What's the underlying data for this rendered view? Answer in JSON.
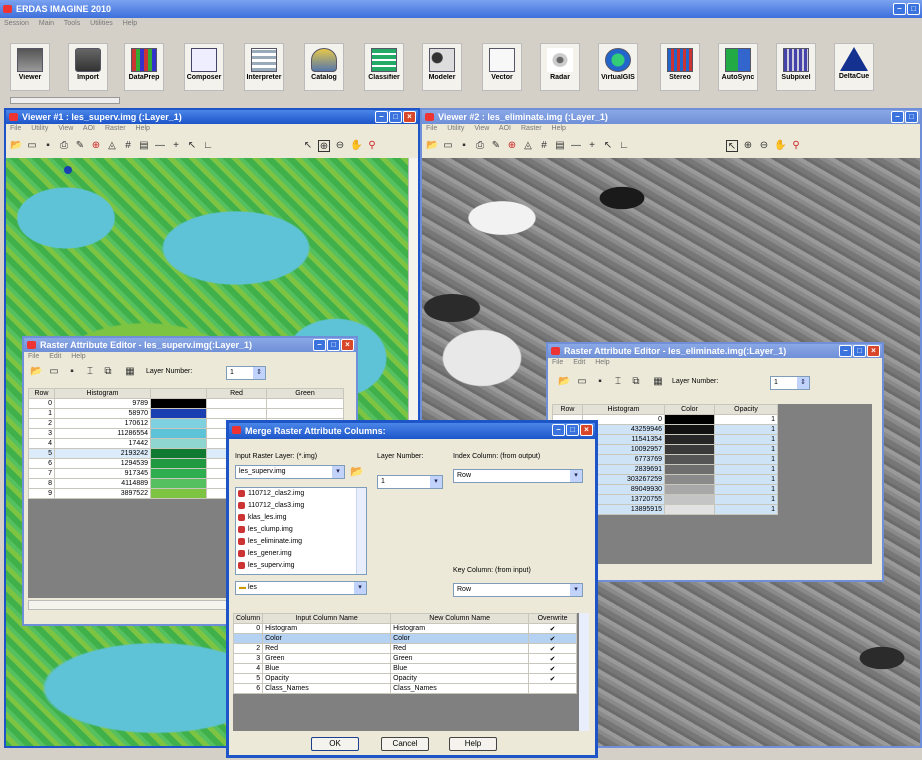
{
  "app": {
    "title": "ERDAS IMAGINE 2010",
    "menu": [
      "Session",
      "Main",
      "Tools",
      "Utilities",
      "Help"
    ]
  },
  "toolbar": [
    {
      "label": "Viewer",
      "icon": "viewer-icon"
    },
    {
      "label": "Import",
      "icon": "import-icon"
    },
    {
      "label": "DataPrep",
      "icon": "dataprep-icon"
    },
    {
      "label": "Composer",
      "icon": "composer-icon"
    },
    {
      "label": "Interpreter",
      "icon": "interpreter-icon"
    },
    {
      "label": "Catalog",
      "icon": "catalog-icon"
    },
    {
      "label": "Classifier",
      "icon": "classifier-icon"
    },
    {
      "label": "Modeler",
      "icon": "modeler-icon"
    },
    {
      "label": "Vector",
      "icon": "vector-icon"
    },
    {
      "label": "Radar",
      "icon": "radar-icon"
    },
    {
      "label": "VirtualGIS",
      "icon": "virtualgis-icon"
    },
    {
      "label": "Stereo",
      "icon": "stereo-icon"
    },
    {
      "label": "AutoSync",
      "icon": "autosync-icon"
    },
    {
      "label": "Subpixel",
      "icon": "subpixel-icon"
    },
    {
      "label": "DeltaCue",
      "icon": "deltacue-icon"
    }
  ],
  "viewer1": {
    "title": "Viewer #1 : les_superv.img (:Layer_1)",
    "menu": [
      "File",
      "Utility",
      "View",
      "AOI",
      "Raster",
      "Help"
    ]
  },
  "viewer2": {
    "title": "Viewer #2 : les_eliminate.img (:Layer_1)",
    "menu": [
      "File",
      "Utility",
      "View",
      "AOI",
      "Raster",
      "Help"
    ]
  },
  "rae1": {
    "title": "Raster Attribute Editor - les_superv.img(:Layer_1)",
    "menu": [
      "File",
      "Edit",
      "Help"
    ],
    "layer_label": "Layer Number:",
    "layer_value": "1",
    "columns": [
      "Row",
      "Histogram",
      "",
      "Red",
      "Green"
    ],
    "rows": [
      {
        "row": "0",
        "hist": "9789",
        "color": "#000000"
      },
      {
        "row": "1",
        "hist": "58970",
        "color": "#1a3fb0"
      },
      {
        "row": "2",
        "hist": "170612",
        "color": "#7fd1e0"
      },
      {
        "row": "3",
        "hist": "11286554",
        "color": "#5fc3d8"
      },
      {
        "row": "4",
        "hist": "17442",
        "color": "#8fd6d0"
      },
      {
        "row": "5",
        "hist": "2193242",
        "color": "#0f7a30"
      },
      {
        "row": "6",
        "hist": "1294539",
        "color": "#1f9a40"
      },
      {
        "row": "7",
        "hist": "917345",
        "color": "#2fae50"
      },
      {
        "row": "8",
        "hist": "4114889",
        "color": "#55c060"
      },
      {
        "row": "9",
        "hist": "3897522",
        "color": "#7cc442"
      }
    ]
  },
  "rae2": {
    "title": "Raster Attribute Editor - les_eliminate.img(:Layer_1)",
    "menu": [
      "File",
      "Edit",
      "Help"
    ],
    "layer_label": "Layer Number:",
    "layer_value": "1",
    "columns": [
      "Row",
      "Histogram",
      "Color",
      "Opacity"
    ],
    "rows": [
      {
        "row": "",
        "hist": "0",
        "color": "#000000",
        "opacity": "1"
      },
      {
        "row": "",
        "hist": "43259946",
        "color": "#111111",
        "opacity": "1"
      },
      {
        "row": "",
        "hist": "11541354",
        "color": "#262626",
        "opacity": "1"
      },
      {
        "row": "",
        "hist": "10092957",
        "color": "#3a3a3a",
        "opacity": "1"
      },
      {
        "row": "",
        "hist": "6773769",
        "color": "#555555",
        "opacity": "1"
      },
      {
        "row": "",
        "hist": "2839691",
        "color": "#6e6e6e",
        "opacity": "1"
      },
      {
        "row": "",
        "hist": "303267259",
        "color": "#8a8a8a",
        "opacity": "1"
      },
      {
        "row": "",
        "hist": "89049930",
        "color": "#a8a8a8",
        "opacity": "1"
      },
      {
        "row": "",
        "hist": "13720755",
        "color": "#c4c4c4",
        "opacity": "1"
      },
      {
        "row": "",
        "hist": "13895915",
        "color": "#e2e2e2",
        "opacity": "1"
      }
    ]
  },
  "merge": {
    "title": "Merge Raster Attribute Columns:",
    "input_label": "Input Raster Layer: (*.img)",
    "input_value": "les_superv.img",
    "files": [
      "110712_clas2.img",
      "110712_clas3.img",
      "klas_les.img",
      "les_clump.img",
      "les_eliminate.img",
      "les_gener.img",
      "les_superv.img"
    ],
    "folder": "les",
    "layer_label": "Layer Number:",
    "layer_value": "1",
    "index_label": "Index Column: (from output)",
    "index_value": "Row",
    "key_label": "Key Column: (from input)",
    "key_value": "Row",
    "columns": [
      "Column",
      "Input Column Name",
      "New Column Name",
      "Overwrite"
    ],
    "rows": [
      {
        "col": "0",
        "input": "Histogram",
        "new": "Histogram",
        "overwrite": "✔"
      },
      {
        "col": "",
        "input": "Color",
        "new": "Color",
        "overwrite": "✔"
      },
      {
        "col": "2",
        "input": "Red",
        "new": "Red",
        "overwrite": "✔"
      },
      {
        "col": "3",
        "input": "Green",
        "new": "Green",
        "overwrite": "✔"
      },
      {
        "col": "4",
        "input": "Blue",
        "new": "Blue",
        "overwrite": "✔"
      },
      {
        "col": "5",
        "input": "Opacity",
        "new": "Opacity",
        "overwrite": "✔"
      },
      {
        "col": "6",
        "input": "Class_Names",
        "new": "Class_Names",
        "overwrite": ""
      }
    ],
    "ok": "OK",
    "cancel": "Cancel",
    "help": "Help"
  },
  "colors": {
    "titlebar": "#1d55c9",
    "accent_green": "#2fae50",
    "accent_cyan": "#5fc3d8"
  }
}
